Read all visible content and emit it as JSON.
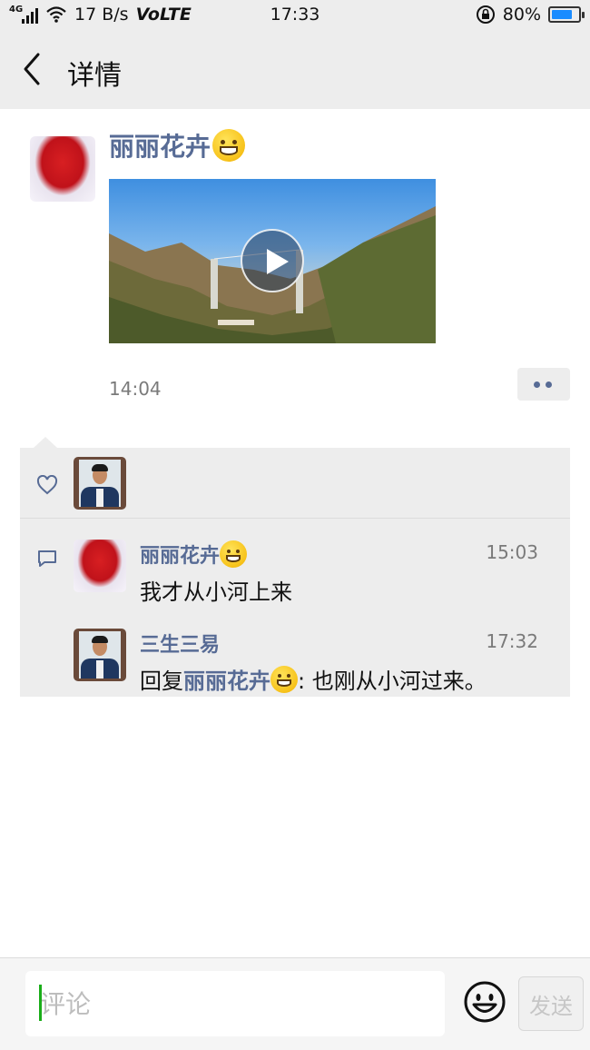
{
  "status_bar": {
    "network": "4G",
    "speed": "17 B/s",
    "volte": "VoLTE",
    "time": "17:33",
    "battery_text": "80%",
    "battery_level": 0.8
  },
  "header": {
    "title": "详情"
  },
  "post": {
    "author": "丽丽花卉",
    "time": "14:04",
    "has_video": true
  },
  "likes": {
    "users": [
      "三生三易"
    ]
  },
  "comments": [
    {
      "name": "丽丽花卉",
      "time": "15:03",
      "text": "我才从小河上来"
    },
    {
      "name": "三生三易",
      "time": "17:32",
      "reply_prefix": "回复",
      "reply_to": "丽丽花卉",
      "text": ": 也刚从小河过来。"
    }
  ],
  "input_bar": {
    "placeholder": "评论",
    "send_label": "发送"
  },
  "colors": {
    "name_blue": "#576b95",
    "bar_gray": "#ededed",
    "battery_blue": "#1a8cff",
    "caret_green": "#1aad19"
  }
}
